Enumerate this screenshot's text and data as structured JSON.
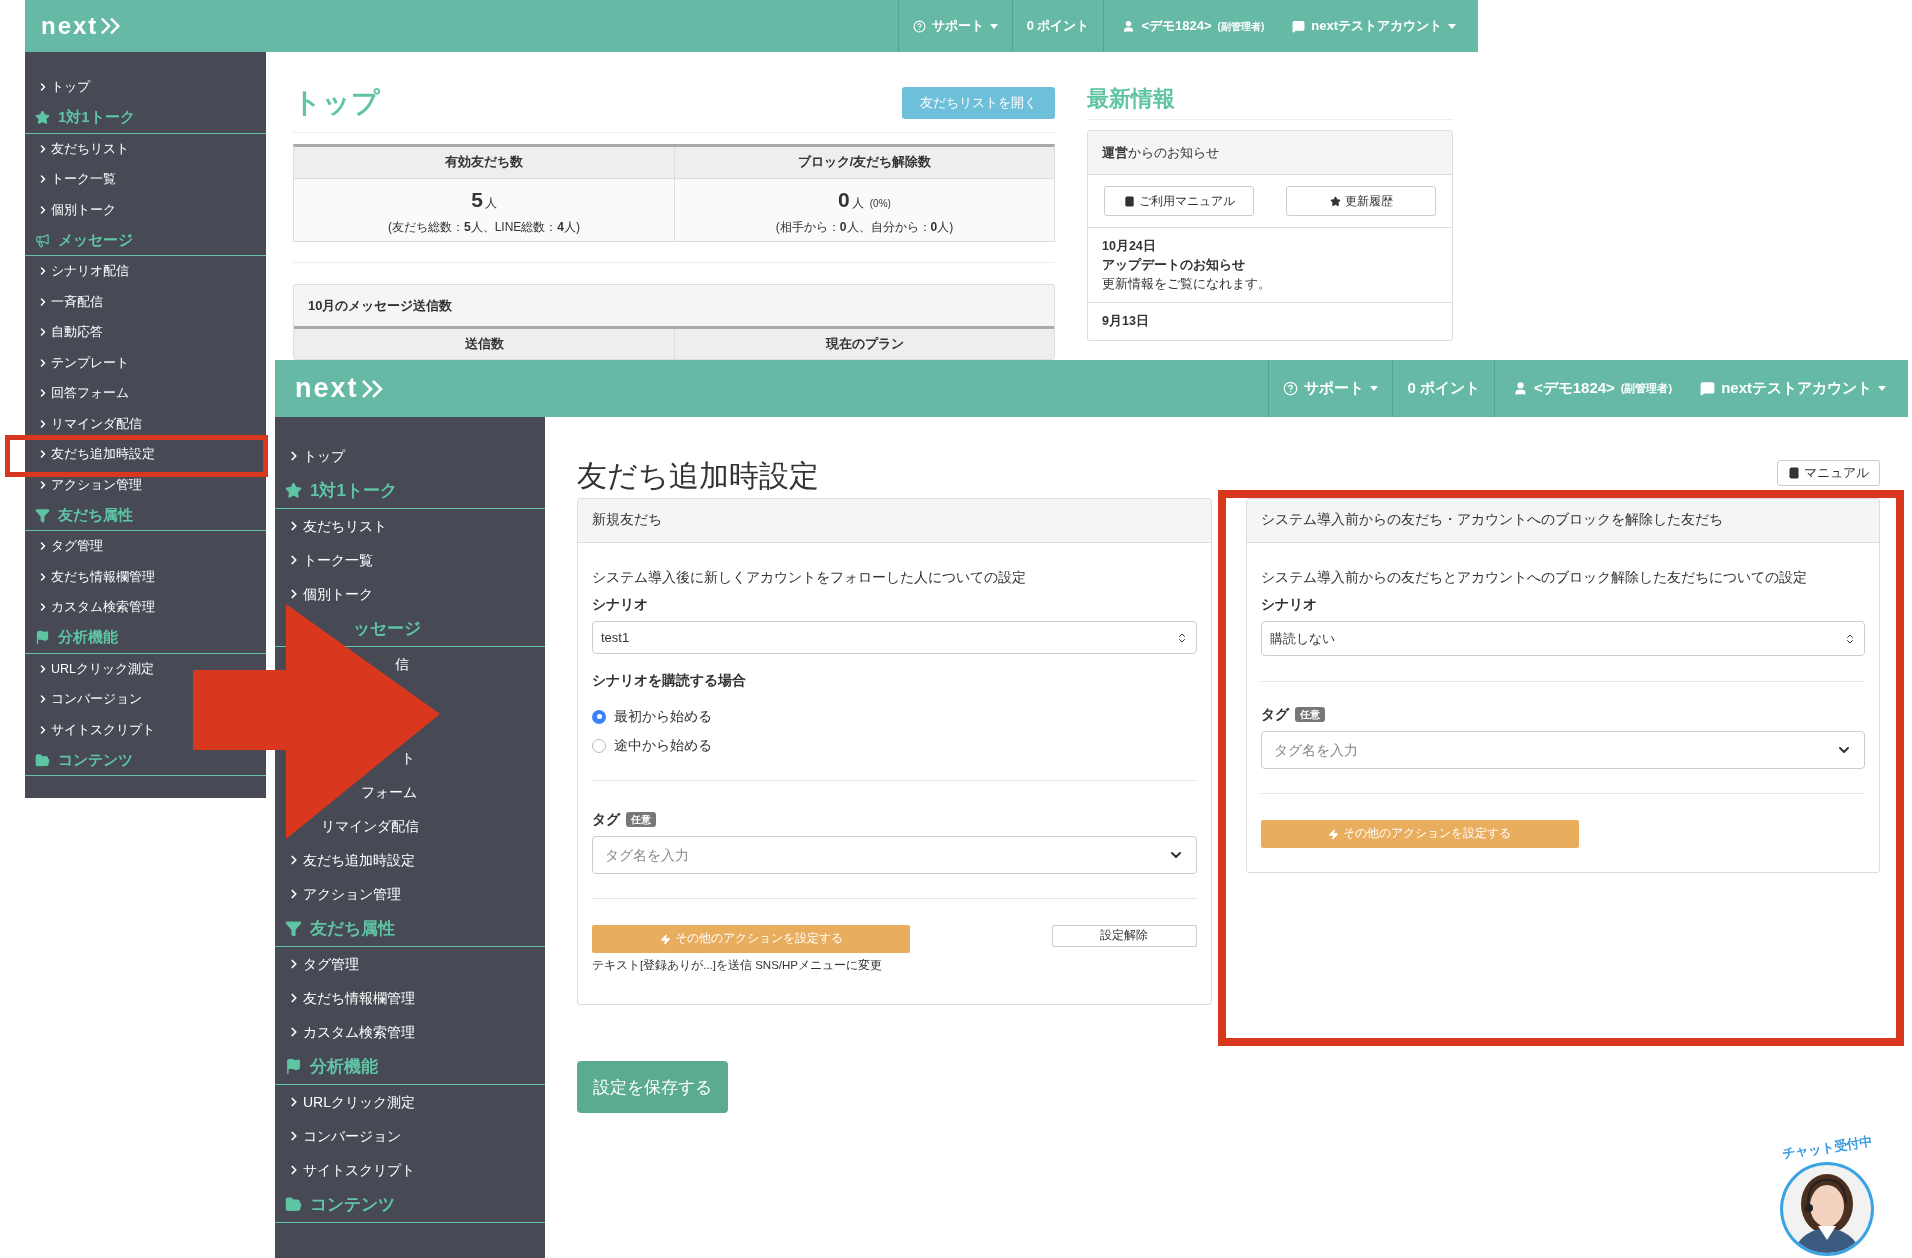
{
  "back_window": {
    "header": {
      "logo": "next",
      "support": "サポート",
      "points": "0 ポイント",
      "user": "<デモ1824>",
      "role": "(副管理者)",
      "account": "nextテストアカウント"
    },
    "sidebar": [
      {
        "kind": "link",
        "label": "トップ"
      },
      {
        "kind": "section",
        "label": "1対1トーク"
      },
      {
        "kind": "link",
        "label": "友だちリスト"
      },
      {
        "kind": "link",
        "label": "トーク一覧"
      },
      {
        "kind": "link",
        "label": "個別トーク"
      },
      {
        "kind": "section",
        "label": "メッセージ"
      },
      {
        "kind": "link",
        "label": "シナリオ配信"
      },
      {
        "kind": "link",
        "label": "一斉配信"
      },
      {
        "kind": "link",
        "label": "自動応答"
      },
      {
        "kind": "link",
        "label": "テンプレート"
      },
      {
        "kind": "link",
        "label": "回答フォーム"
      },
      {
        "kind": "link",
        "label": "リマインダ配信"
      },
      {
        "kind": "link",
        "label": "友だち追加時設定"
      },
      {
        "kind": "link",
        "label": "アクション管理"
      },
      {
        "kind": "section",
        "label": "友だち属性"
      },
      {
        "kind": "link",
        "label": "タグ管理"
      },
      {
        "kind": "link",
        "label": "友だち情報欄管理"
      },
      {
        "kind": "link",
        "label": "カスタム検索管理"
      },
      {
        "kind": "section",
        "label": "分析機能"
      },
      {
        "kind": "link",
        "label": "URLクリック測定"
      },
      {
        "kind": "link",
        "label": "コンバージョン"
      },
      {
        "kind": "link",
        "label": "サイトスクリプト"
      },
      {
        "kind": "section",
        "label": "コンテンツ"
      }
    ],
    "title": "トップ",
    "open_button": "友だちリストを開く",
    "stats": [
      {
        "heading": "有効友だち数",
        "value": "5",
        "unit": "人",
        "detail": "(友だち総数：**5**人、LINE総数：**4**人)"
      },
      {
        "heading": "ブロック/友だち解除数",
        "value": "0",
        "unit": "人",
        "percent": "(0%)",
        "detail": "(相手から：**0**人、自分から：**0**人)"
      }
    ],
    "monthly_panel": {
      "title": "10月のメッセージ送信数",
      "columns": [
        "送信数",
        "現在のプラン"
      ]
    },
    "news": {
      "title": "最新情報",
      "panel_title": "**運営**からのお知らせ",
      "buttons": [
        "ご利用マニュアル",
        "更新履歴"
      ],
      "items": [
        {
          "date": "10月24日",
          "title": "アップデートのお知らせ",
          "body": "更新情報をご覧になれます。"
        },
        {
          "date": "9月13日"
        }
      ]
    }
  },
  "front_window": {
    "header": {
      "logo": "next",
      "support": "サポート",
      "points": "0 ポイント",
      "user": "<デモ1824>",
      "role": "(副管理者)",
      "account": "nextテストアカウント"
    },
    "sidebar": [
      {
        "kind": "link",
        "label": "トップ"
      },
      {
        "kind": "section",
        "label": "1対1トーク"
      },
      {
        "kind": "link",
        "label": "友だちリスト"
      },
      {
        "kind": "link",
        "label": "トーク一覧"
      },
      {
        "kind": "link",
        "label": "個別トーク"
      },
      {
        "kind": "section_partial",
        "label": "ッセージ"
      },
      {
        "kind": "partial",
        "label": "信"
      },
      {
        "kind": "partial",
        "label": "ト"
      },
      {
        "kind": "partial",
        "label": "フォーム"
      },
      {
        "kind": "partial",
        "label": "リマインダ配信"
      },
      {
        "kind": "link",
        "label": "友だち追加時設定"
      },
      {
        "kind": "link",
        "label": "アクション管理"
      },
      {
        "kind": "section",
        "label": "友だち属性"
      },
      {
        "kind": "link",
        "label": "タグ管理"
      },
      {
        "kind": "link",
        "label": "友だち情報欄管理"
      },
      {
        "kind": "link",
        "label": "カスタム検索管理"
      },
      {
        "kind": "section",
        "label": "分析機能"
      },
      {
        "kind": "link",
        "label": "URLクリック測定"
      },
      {
        "kind": "link",
        "label": "コンバージョン"
      },
      {
        "kind": "link",
        "label": "サイトスクリプト"
      },
      {
        "kind": "section",
        "label": "コンテンツ"
      }
    ],
    "title": "友だち追加時設定",
    "manual_button": "マニュアル",
    "panels": [
      {
        "heading": "新規友だち",
        "description": "システム導入後に新しくアカウントをフォローした人についての設定",
        "scenario_label": "シナリオ",
        "scenario_value": "test1",
        "subscribe": {
          "label": "シナリオを購読する場合",
          "options": [
            {
              "label": "最初から始める",
              "selected": true
            },
            {
              "label": "途中から始める",
              "selected": false
            }
          ]
        },
        "tag_label": "タグ",
        "optional_badge": "任意",
        "tag_placeholder": "タグ名を入力",
        "action_button": "その他のアクションを設定する",
        "clear_button": "設定解除",
        "action_summary": "テキスト[登録ありが...]を送信 SNS/HPメニューに変更"
      },
      {
        "heading": "システム導入前からの友だち・アカウントへのブロックを解除した友だち",
        "description": "システム導入前からの友だちとアカウントへのブロック解除した友だちについての設定",
        "scenario_label": "シナリオ",
        "scenario_value": "購読しない",
        "tag_label": "タグ",
        "optional_badge": "任意",
        "tag_placeholder": "タグ名を入力",
        "action_button": "その他のアクションを設定する"
      }
    ],
    "save_button": "設定を保存する",
    "chat_badge": "チャット受付中"
  }
}
